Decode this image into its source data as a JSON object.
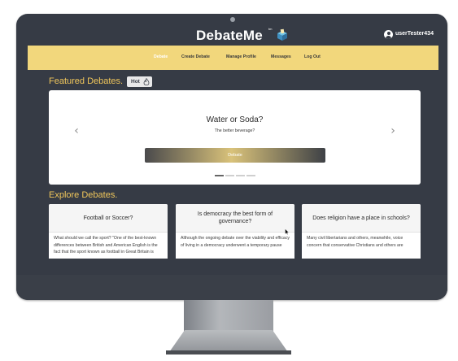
{
  "header": {
    "logo": "DebateMe",
    "logo_mark": "tm",
    "logo_icon": "ballot-box-icon",
    "user_icon": "user-circle-icon",
    "username": "userTester434"
  },
  "nav": {
    "items": [
      {
        "label": "Debate",
        "active": true
      },
      {
        "label": "Create Debate",
        "active": false
      },
      {
        "label": "Manage Profile",
        "active": false
      },
      {
        "label": "Messages",
        "active": false
      },
      {
        "label": "Log Out",
        "active": false
      }
    ]
  },
  "featured": {
    "title": "Featured Debates.",
    "badge": "Hot",
    "badge_icon": "flame-icon",
    "slide": {
      "title": "Water or Soda?",
      "subtitle": "The better beverage?",
      "button": "Debate"
    },
    "slides_total": 4,
    "active_slide": 1,
    "prev_icon": "chevron-left-icon",
    "next_icon": "chevron-right-icon"
  },
  "explore": {
    "title": "Explore Debates.",
    "cards": [
      {
        "title": "Football or Soccer?",
        "text": "What should we call the sport? \"One of the best-known differences between British and American English is the fact that the sport known as football in Great Britain is"
      },
      {
        "title": "Is democracy the best form of governance?",
        "text": "Although the ongoing debate over the viability and efficacy of living in a democracy underwent a temporary pause"
      },
      {
        "title": "Does religion have a place in schools?",
        "text": "Many civil libertarians and others, meanwhile, voice concern that conservative Christians and others are"
      }
    ]
  },
  "colors": {
    "frame": "#363b45",
    "accent": "#f2d77c",
    "heading": "#f0c65b"
  }
}
